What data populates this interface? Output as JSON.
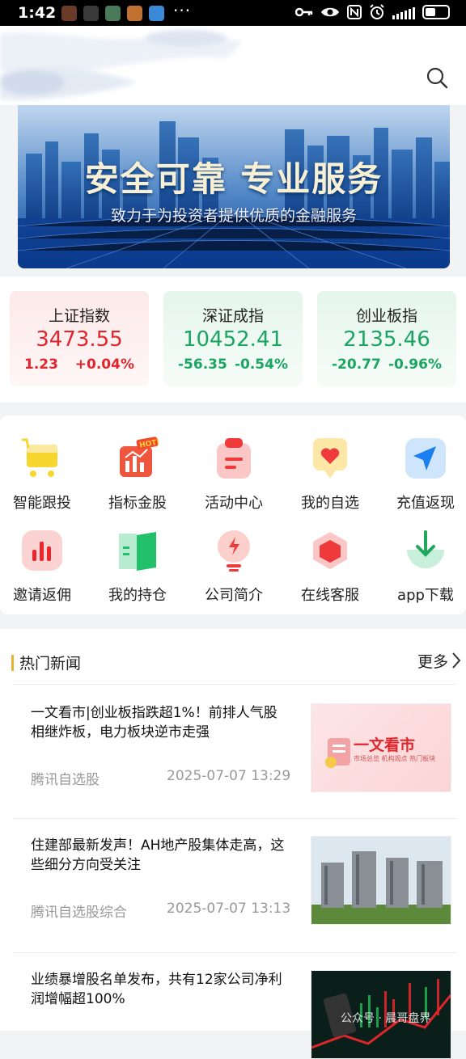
{
  "status_bar": {
    "time": "1:42",
    "more": "···",
    "app_colors": [
      "#6b3b2a",
      "#3a3a3a",
      "#4a7a5a",
      "#c07030",
      "#3a8ad8"
    ]
  },
  "banner": {
    "title": "安全可靠 专业服务",
    "subtitle": "致力于为投资者提供优质的金融服务"
  },
  "indices": [
    {
      "name": "上证指数",
      "value": "3473.55",
      "change": "1.23",
      "percent": "+0.04%",
      "trend": "up"
    },
    {
      "name": "深证成指",
      "value": "10452.41",
      "change": "-56.35",
      "percent": "-0.54%",
      "trend": "down"
    },
    {
      "name": "创业板指",
      "value": "2135.46",
      "change": "-20.77",
      "percent": "-0.96%",
      "trend": "down"
    }
  ],
  "quick_menu": [
    {
      "label": "智能跟投",
      "icon": "cart-icon"
    },
    {
      "label": "指标金股",
      "icon": "hot-chart-icon"
    },
    {
      "label": "活动中心",
      "icon": "clipboard-icon"
    },
    {
      "label": "我的自选",
      "icon": "heart-icon"
    },
    {
      "label": "充值返现",
      "icon": "send-icon"
    },
    {
      "label": "邀请返佣",
      "icon": "bar-chart-icon"
    },
    {
      "label": "我的持仓",
      "icon": "book-icon"
    },
    {
      "label": "公司简介",
      "icon": "bulb-icon"
    },
    {
      "label": "在线客服",
      "icon": "hexagon-icon"
    },
    {
      "label": "app下载",
      "icon": "download-icon"
    }
  ],
  "news": {
    "heading": "热门新闻",
    "more_label": "更多",
    "items": [
      {
        "title": "一文看市|创业板指跌超1%！前排人气股相继炸板，电力板块逆市走强",
        "source": "腾讯自选股",
        "time": "2025-07-07 13:29",
        "thumb_text": "一文看市",
        "thumb_sub": "市场总览  机构观点  热门板块"
      },
      {
        "title": "住建部最新发声！AH地产股集体走高，这些细分方向受关注",
        "source": "腾讯自选股综合",
        "time": "2025-07-07 13:13"
      },
      {
        "title": "业绩暴增股名单发布，共有12家公司净利润增幅超100%",
        "source": "",
        "time": "",
        "watermark": "公众号 · 晨哥盘界"
      }
    ]
  }
}
